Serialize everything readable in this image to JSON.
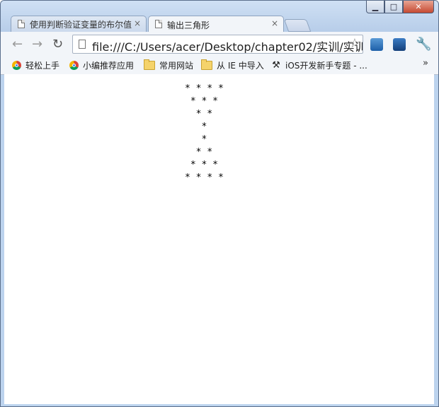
{
  "browser": {
    "tabs": [
      {
        "title": "使用判断验证变量的布尔值",
        "close": "×",
        "active": false
      },
      {
        "title": "输出三角形",
        "close": "×",
        "active": true
      }
    ],
    "window_controls": {
      "minimize": "▁",
      "maximize": "□",
      "close": "✕"
    },
    "address": "file:///C:/Users/acer/Desktop/chapter02/实训/实训",
    "nav": {
      "back": "←",
      "forward": "→",
      "reload": "↻"
    },
    "star": "☆",
    "wrench": "🔧",
    "bookmarks": [
      {
        "label": "轻松上手",
        "icon": "chrome-icon"
      },
      {
        "label": "小编推荐应用",
        "icon": "chrome-icon"
      },
      {
        "label": "常用网站",
        "icon": "folder-icon"
      },
      {
        "label": "从 IE 中导入",
        "icon": "folder-icon"
      },
      {
        "label": "iOS开发新手专题 - ...",
        "icon": "ios-icon"
      }
    ],
    "bookmarks_more": "»"
  },
  "page": {
    "stars_lines": [
      "* * * *",
      " * * *",
      "  * *",
      "   *",
      "   *",
      "  * *",
      " * * *",
      "* * * *"
    ]
  }
}
